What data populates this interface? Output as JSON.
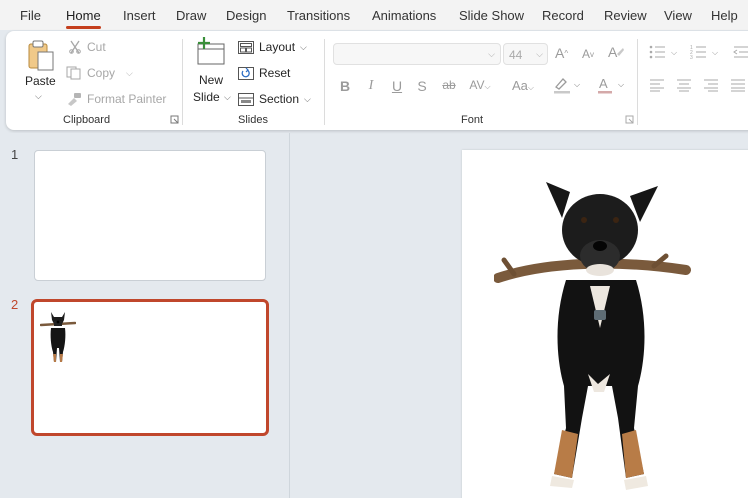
{
  "tabs": [
    "File",
    "Home",
    "Insert",
    "Draw",
    "Design",
    "Transitions",
    "Animations",
    "Slide Show",
    "Record",
    "Review",
    "View",
    "Help"
  ],
  "active_tab": "Home",
  "clipboard": {
    "paste_label": "Paste",
    "cut_label": "Cut",
    "copy_label": "Copy",
    "format_painter_label": "Format Painter",
    "group_label": "Clipboard"
  },
  "slides_group": {
    "new_slide_line1": "New",
    "new_slide_line2": "Slide",
    "layout_label": "Layout",
    "reset_label": "Reset",
    "section_label": "Section",
    "group_label": "Slides"
  },
  "font_group": {
    "font_name_value": "",
    "font_size_value": "44",
    "group_label": "Font"
  },
  "thumbnails": [
    {
      "number": "1"
    },
    {
      "number": "2"
    }
  ],
  "colors": {
    "accent": "#c43e1c",
    "selected_thumb_border": "#c0472c",
    "background": "#e4e9ee"
  }
}
